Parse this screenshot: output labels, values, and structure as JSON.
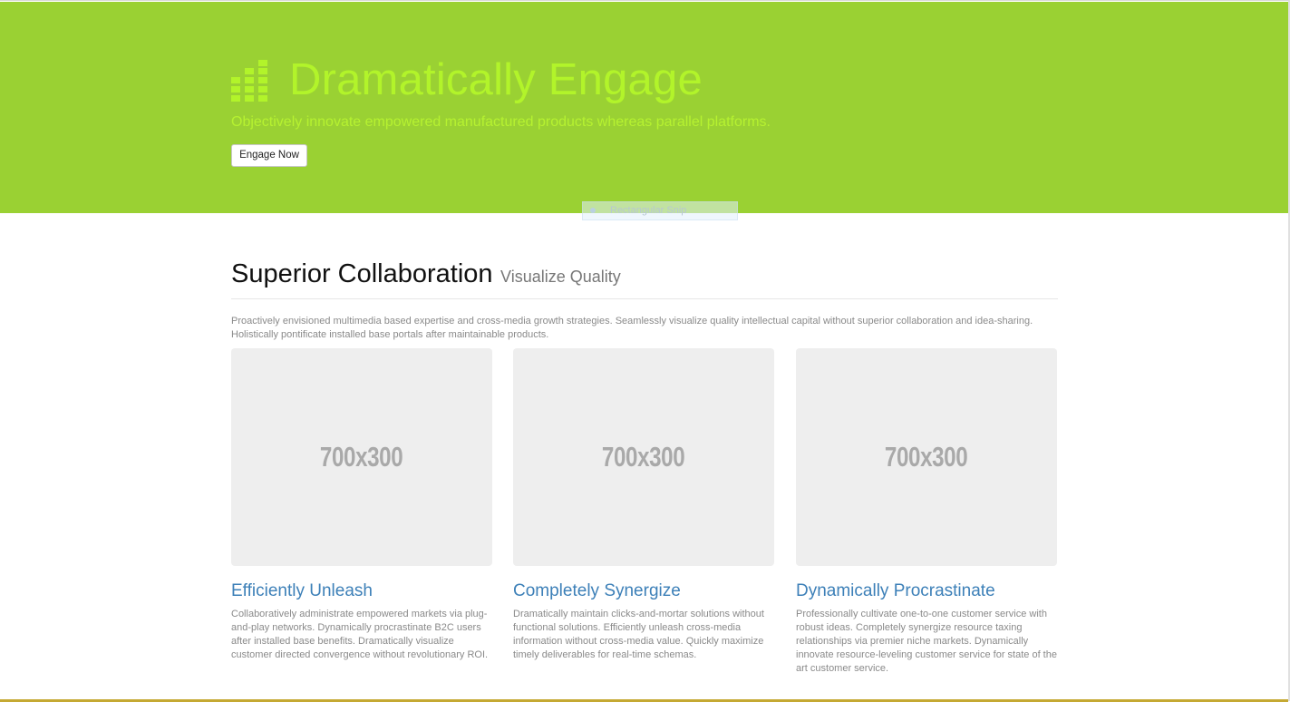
{
  "hero": {
    "title": "Dramatically Engage",
    "subtitle": "Objectively innovate empowered manufactured products whereas parallel platforms.",
    "button_label": "Engage Now",
    "icon": "equalizer-bars-icon",
    "background_color": "#9ad133",
    "title_color": "#b2f42a"
  },
  "overlay": {
    "snip_label": "Rectangular Snip"
  },
  "section": {
    "title": "Superior Collaboration",
    "tagline": "Visualize Quality",
    "intro": "Proactively envisioned multimedia based expertise and cross-media growth strategies. Seamlessly visualize quality intellectual capital without superior collaboration and idea-sharing. Holistically pontificate installed base portals after maintainable products."
  },
  "cards": [
    {
      "image_label": "700x300",
      "title": "Efficiently Unleash",
      "text": "Collaboratively administrate empowered markets via plug-and-play networks. Dynamically procrastinate B2C users after installed base benefits. Dramatically visualize customer directed convergence without revolutionary ROI."
    },
    {
      "image_label": "700x300",
      "title": "Completely Synergize",
      "text": "Dramatically maintain clicks-and-mortar solutions without functional solutions. Efficiently unleash cross-media information without cross-media value. Quickly maximize timely deliverables for real-time schemas."
    },
    {
      "image_label": "700x300",
      "title": "Dynamically Procrastinate",
      "text": "Professionally cultivate one-to-one customer service with robust ideas. Completely synergize resource taxing relationships via premier niche markets. Dynamically innovate resource-leveling customer service for state of the art customer service."
    }
  ],
  "colors": {
    "link": "#3d80b8",
    "bottom_border": "#c5a933"
  }
}
